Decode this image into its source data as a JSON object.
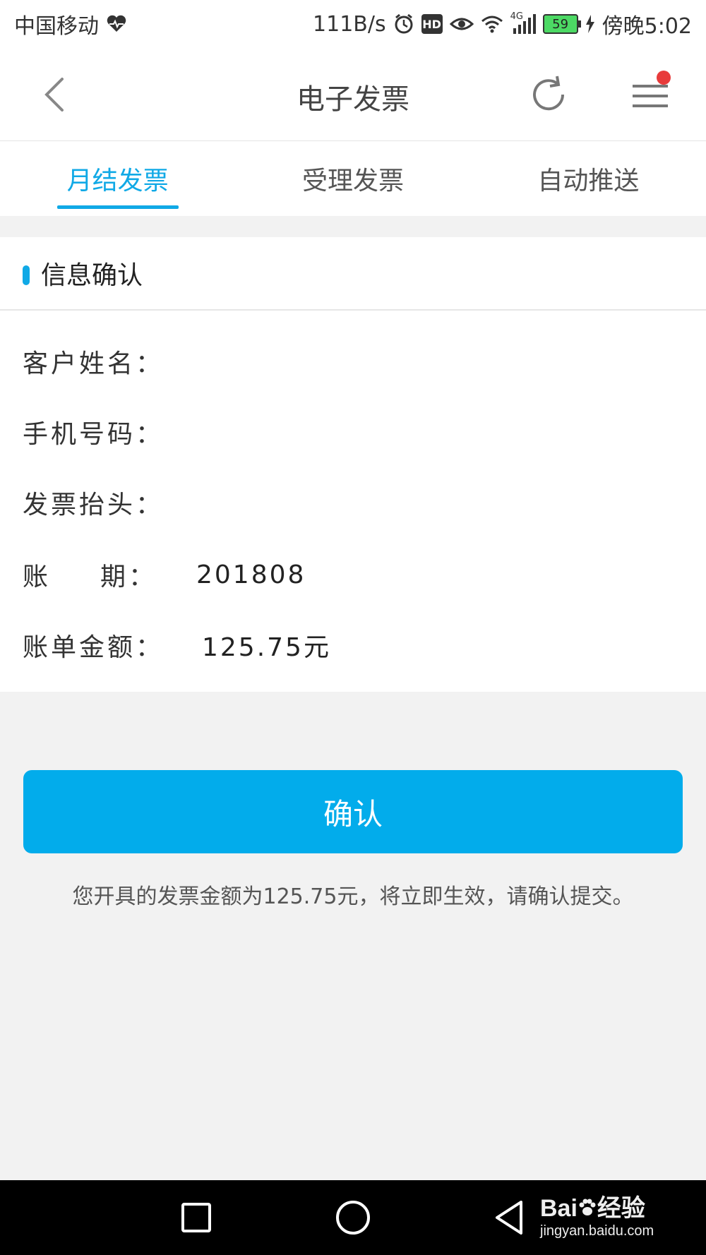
{
  "status_bar": {
    "carrier": "中国移动",
    "speed": "111B/s",
    "network": "4G",
    "battery": "59",
    "time": "傍晚5:02"
  },
  "header": {
    "title": "电子发票",
    "notification_color": "#e83b3b"
  },
  "tabs": [
    {
      "label": "月结发票",
      "active": true
    },
    {
      "label": "受理发票",
      "active": false
    },
    {
      "label": "自动推送",
      "active": false
    }
  ],
  "section": {
    "title": "信息确认"
  },
  "info": {
    "customer_name_label": "客户姓名：",
    "customer_name_value": "",
    "phone_label": "手机号码：",
    "phone_value": "",
    "invoice_title_label": "发票抬头：",
    "invoice_title_value": "",
    "period_label_1": "账",
    "period_label_2": "期：",
    "period_value": "201808",
    "amount_label": "账单金额：",
    "amount_value": "125.75元"
  },
  "confirm_button": {
    "label": "确认"
  },
  "notice": "您开具的发票金额为125.75元，将立即生效，请确认提交。",
  "watermark": {
    "brand_1": "Bai",
    "brand_2": "经验",
    "url": "jingyan.baidu.com"
  },
  "colors": {
    "accent": "#10a9e6",
    "button": "#02aceb",
    "background": "#f2f2f2"
  }
}
